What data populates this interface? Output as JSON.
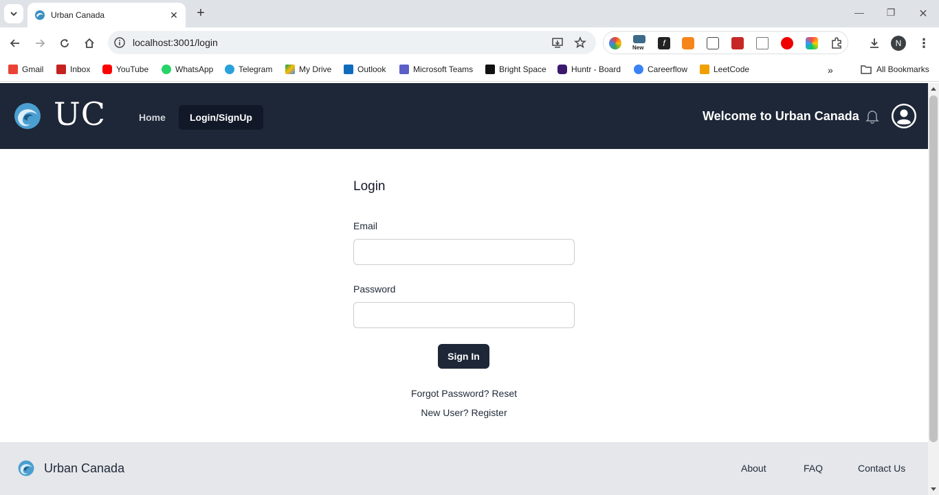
{
  "browser": {
    "tab_title": "Urban Canada",
    "url": "localhost:3001/login",
    "profile_initial": "N",
    "new_badge": "New",
    "bookmarks": [
      {
        "label": "Gmail",
        "color": "#ea4335"
      },
      {
        "label": "Inbox",
        "color": "#c5221f"
      },
      {
        "label": "YouTube",
        "color": "#ff0000"
      },
      {
        "label": "WhatsApp",
        "color": "#25d366"
      },
      {
        "label": "Telegram",
        "color": "#2aa1da"
      },
      {
        "label": "My Drive",
        "color": "#fbbc04"
      },
      {
        "label": "Outlook",
        "color": "#0f6cbd"
      },
      {
        "label": "Microsoft Teams",
        "color": "#5b5fc7"
      },
      {
        "label": "Bright Space",
        "color": "#111111"
      },
      {
        "label": "Huntr - Board",
        "color": "#3b1a6e"
      },
      {
        "label": "Careerflow",
        "color": "#3b82f6"
      },
      {
        "label": "LeetCode",
        "color": "#f0a000"
      }
    ],
    "all_bookmarks": "All Bookmarks"
  },
  "header": {
    "logo_text": "UC",
    "nav_home": "Home",
    "nav_login": "Login/SignUp",
    "welcome": "Welcome to Urban Canada"
  },
  "login": {
    "title": "Login",
    "email_label": "Email",
    "email_value": "",
    "password_label": "Password",
    "password_value": "",
    "signin_label": "Sign In",
    "forgot_text": "Forgot Password? Reset",
    "register_text": "New User? Register"
  },
  "footer": {
    "brand": "Urban Canada",
    "links": [
      "About",
      "FAQ",
      "Contact Us"
    ]
  },
  "colors": {
    "header_bg": "#1e2737",
    "active_nav_bg": "#111827",
    "footer_bg": "#e5e7eb"
  }
}
